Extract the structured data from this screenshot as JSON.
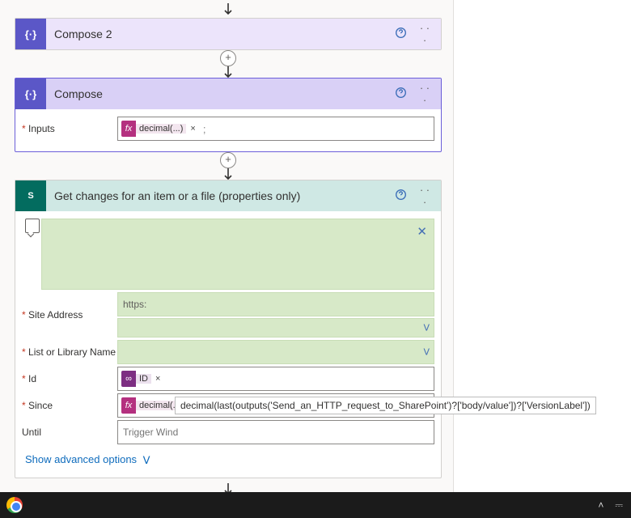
{
  "flow": {
    "compose2": {
      "title": "Compose 2"
    },
    "compose": {
      "title": "Compose",
      "inputs_label": "Inputs",
      "token_fx": "decimal(...)"
    },
    "sharepoint": {
      "title": "Get changes for an item or a file (properties only)",
      "fields": {
        "site_label": "Site Address",
        "site_value": "https:",
        "list_label": "List or Library Name",
        "id_label": "Id",
        "id_token": "ID",
        "since_label": "Since",
        "since_token": "decimal(...)",
        "until_label": "Until",
        "until_placeholder": "Trigger Wind"
      },
      "show_advanced": "Show advanced options"
    }
  },
  "tooltip": "decimal(last(outputs('Send_an_HTTP_request_to_SharePoint')?['body/value'])?['VersionLabel'])",
  "icons": {
    "fx": "fx",
    "sp": "S",
    "compose": "{·}",
    "link": "∞"
  },
  "taskbar": {
    "tray_caret": "˄",
    "tray_bat": "⎓"
  }
}
